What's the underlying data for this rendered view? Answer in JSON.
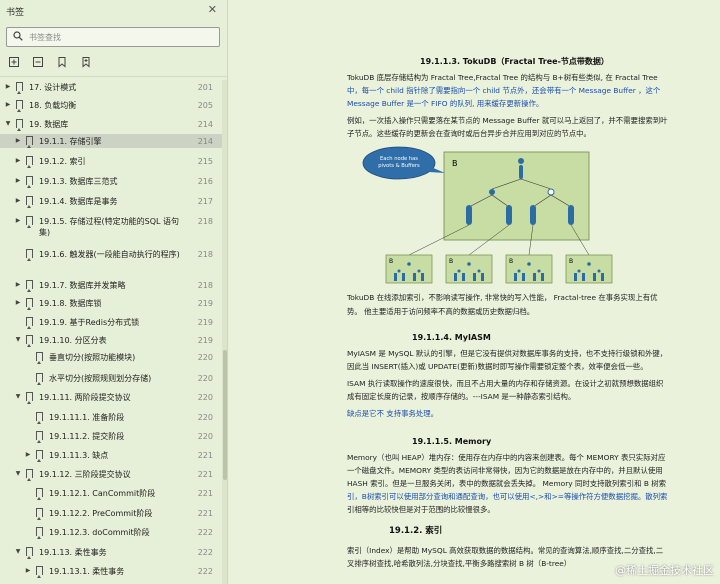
{
  "sidebar": {
    "title": "书签",
    "search_placeholder": "书签查找",
    "toc": [
      {
        "label": "17. 设计模式",
        "page": "201",
        "level": 0,
        "arrow": "▶"
      },
      {
        "label": "18. 负载均衡",
        "page": "205",
        "level": 0,
        "arrow": "▶"
      },
      {
        "label": "19. 数据库",
        "page": "214",
        "level": 0,
        "arrow": "▼"
      },
      {
        "label": "19.1.1. 存储引擎",
        "page": "214",
        "level": 1,
        "arrow": "▶",
        "selected": true
      },
      {
        "label": "19.1.2. 索引",
        "page": "215",
        "level": 1,
        "arrow": "▶"
      },
      {
        "label": "19.1.3. 数据库三范式",
        "page": "216",
        "level": 1,
        "arrow": "▶"
      },
      {
        "label": "19.1.4. 数据库是事务",
        "page": "217",
        "level": 1,
        "arrow": "▶"
      },
      {
        "label": "19.1.5. 存储过程(特定功能的SQL 语句集)",
        "page": "218",
        "level": 1,
        "arrow": "▶"
      },
      {
        "label": "19.1.6. 触发器(一段能自动执行的程序)",
        "page": "218",
        "level": 1,
        "arrow": ""
      },
      {
        "label": "19.1.7. 数据库并发策略",
        "page": "218",
        "level": 1,
        "arrow": "▶"
      },
      {
        "label": "19.1.8. 数据库锁",
        "page": "219",
        "level": 1,
        "arrow": "▶"
      },
      {
        "label": "19.1.9. 基于Redis分布式锁",
        "page": "219",
        "level": 1,
        "arrow": ""
      },
      {
        "label": "19.1.10. 分区分表",
        "page": "219",
        "level": 1,
        "arrow": "▼"
      },
      {
        "label": "垂直切分(按照功能模块)",
        "page": "220",
        "level": 2,
        "arrow": ""
      },
      {
        "label": "水平切分(按照规则划分存储)",
        "page": "220",
        "level": 2,
        "arrow": ""
      },
      {
        "label": "19.1.11. 两阶段提交协议",
        "page": "220",
        "level": 1,
        "arrow": "▼"
      },
      {
        "label": "19.1.11.1. 准备阶段",
        "page": "220",
        "level": 2,
        "arrow": ""
      },
      {
        "label": "19.1.11.2. 提交阶段",
        "page": "220",
        "level": 2,
        "arrow": ""
      },
      {
        "label": "19.1.11.3. 缺点",
        "page": "221",
        "level": 2,
        "arrow": "▶"
      },
      {
        "label": "19.1.12. 三阶段提交协议",
        "page": "221",
        "level": 1,
        "arrow": "▼"
      },
      {
        "label": "19.1.12.1. CanCommit阶段",
        "page": "221",
        "level": 2,
        "arrow": ""
      },
      {
        "label": "19.1.12.2. PreCommit阶段",
        "page": "221",
        "level": 2,
        "arrow": ""
      },
      {
        "label": "19.1.12.3. doCommit阶段",
        "page": "222",
        "level": 2,
        "arrow": ""
      },
      {
        "label": "19.1.13. 柔性事务",
        "page": "222",
        "level": 1,
        "arrow": "▼"
      },
      {
        "label": "19.1.13.1. 柔性事务",
        "page": "222",
        "level": 2,
        "arrow": "▶"
      }
    ]
  },
  "document": {
    "h_tokudb": "19.1.1.3.   TokuDB（Fractal Tree-节点带数据）",
    "tokudb_p1a": "TokuDB 底层存储结构为 Fractal Tree,Fractal Tree 的结构与 B+树有些类似, 在 Fractal Tree",
    "tokudb_p1b": "中，每一个 child 指针除了需要指向一个 child 节点外，还会带有一个 Message Buffer ，这个",
    "tokudb_p1c": "Message Buffer 是一个 FIFO 的队列, 用来缓存更新操作。",
    "tokudb_p2a": "例如，一次插入操作只需要落在某节点的 Message Buffer 就可以马上返回了，并不需要搜索到叶",
    "tokudb_p2b": "子节点。这些缓存的更新会在查询时或后台异步合并应用到对应的节点中。",
    "fig_callout": "Each node has pivots & Buffers",
    "fig_root_label": "B",
    "tokudb_p3a": "TokuDB 在线添加索引，不影响读写操作, 非常快的写入性能，  Fractal-tree 在事务实现上有优",
    "tokudb_p3b": "势。 他主要适用于访问频率不高的数据或历史数据归档。",
    "h_myiasm": "19.1.1.4.   MyIASM",
    "myiasm_p1a": "MyIASM 是 MySQL 默认的引擎，但是它没有提供对数据库事务的支持，也不支持行级锁和外键，",
    "myiasm_p1b": "因此当 INSERT(插入)或 UPDATE(更新)数据时即写操作需要锁定整个表，效率便会低一些。",
    "myiasm_p2a": "ISAM 执行读取操作的速度很快，而且不占用大量的内存和存储资源。在设计之初就预想数据组织",
    "myiasm_p2b": "成有固定长度的记录，按顺序存储的。---ISAM 是一种静态索引结构。",
    "myiasm_p3": "缺点是它不 支持事务处理。",
    "h_memory": "19.1.1.5.   Memory",
    "mem_p1a": "Memory（也叫 HEAP）堆内存：使用存在内存中的内容来创建表。每个 MEMORY 表只实际对应",
    "mem_p1b": "一个磁盘文件。MEMORY 类型的表访问非常得快，因为它的数据是放在内存中的，并且默认使用",
    "mem_p1c": "HASH 索引。但是一旦服务关闭，表中的数据就会丢失掉。  Memory 同时支持散列索引和 B 树索",
    "mem_p1d": "引，B树索引可以使用部分查询和通配查询，也可以使用<,>和>=等操作符方便数据挖掘。散列索",
    "mem_p1e": "引相等的比较快但是对于范围的比较慢很多。",
    "h_index": "19.1.2.    索引",
    "idx_p1a": "索引（Index）是帮助 MySQL 高效获取数据的数据结构。常见的查询算法,顺序查找,二分查找,二",
    "idx_p1b": "叉排序树查找,哈希散列法,分块查找,平衡多路搜索树 B 树（B-tree）"
  },
  "watermark": "@稀土掘金技术社区",
  "colors": {
    "sidebar_bg": "#e6efd7",
    "doc_bg": "#eaf2dc",
    "link_blue": "#1a4dae",
    "selected_row": "#cdd3c4",
    "tree_node": "#2b6ca3"
  }
}
